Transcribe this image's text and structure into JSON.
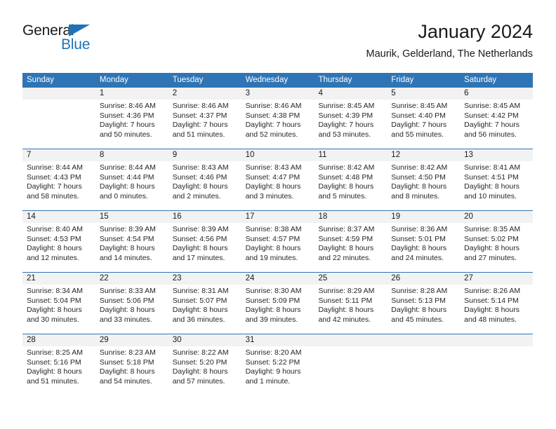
{
  "brand": {
    "word1": "General",
    "word2": "Blue",
    "triangle_color": "#1f72b8"
  },
  "header": {
    "title": "January 2024",
    "subtitle": "Maurik, Gelderland, The Netherlands"
  },
  "theme": {
    "header_blue": "#2f74b5",
    "daynum_band": "#f2f2f2",
    "text": "#262626"
  },
  "calendar": {
    "weekday_headers": [
      "Sunday",
      "Monday",
      "Tuesday",
      "Wednesday",
      "Thursday",
      "Friday",
      "Saturday"
    ],
    "weeks": [
      {
        "numbers": [
          "",
          "1",
          "2",
          "3",
          "4",
          "5",
          "6"
        ],
        "cells": [
          {
            "lines": [
              "",
              "",
              "",
              ""
            ]
          },
          {
            "lines": [
              "Sunrise: 8:46 AM",
              "Sunset: 4:36 PM",
              "Daylight: 7 hours",
              "and 50 minutes."
            ]
          },
          {
            "lines": [
              "Sunrise: 8:46 AM",
              "Sunset: 4:37 PM",
              "Daylight: 7 hours",
              "and 51 minutes."
            ]
          },
          {
            "lines": [
              "Sunrise: 8:46 AM",
              "Sunset: 4:38 PM",
              "Daylight: 7 hours",
              "and 52 minutes."
            ]
          },
          {
            "lines": [
              "Sunrise: 8:45 AM",
              "Sunset: 4:39 PM",
              "Daylight: 7 hours",
              "and 53 minutes."
            ]
          },
          {
            "lines": [
              "Sunrise: 8:45 AM",
              "Sunset: 4:40 PM",
              "Daylight: 7 hours",
              "and 55 minutes."
            ]
          },
          {
            "lines": [
              "Sunrise: 8:45 AM",
              "Sunset: 4:42 PM",
              "Daylight: 7 hours",
              "and 56 minutes."
            ]
          }
        ]
      },
      {
        "numbers": [
          "7",
          "8",
          "9",
          "10",
          "11",
          "12",
          "13"
        ],
        "cells": [
          {
            "lines": [
              "Sunrise: 8:44 AM",
              "Sunset: 4:43 PM",
              "Daylight: 7 hours",
              "and 58 minutes."
            ]
          },
          {
            "lines": [
              "Sunrise: 8:44 AM",
              "Sunset: 4:44 PM",
              "Daylight: 8 hours",
              "and 0 minutes."
            ]
          },
          {
            "lines": [
              "Sunrise: 8:43 AM",
              "Sunset: 4:46 PM",
              "Daylight: 8 hours",
              "and 2 minutes."
            ]
          },
          {
            "lines": [
              "Sunrise: 8:43 AM",
              "Sunset: 4:47 PM",
              "Daylight: 8 hours",
              "and 3 minutes."
            ]
          },
          {
            "lines": [
              "Sunrise: 8:42 AM",
              "Sunset: 4:48 PM",
              "Daylight: 8 hours",
              "and 5 minutes."
            ]
          },
          {
            "lines": [
              "Sunrise: 8:42 AM",
              "Sunset: 4:50 PM",
              "Daylight: 8 hours",
              "and 8 minutes."
            ]
          },
          {
            "lines": [
              "Sunrise: 8:41 AM",
              "Sunset: 4:51 PM",
              "Daylight: 8 hours",
              "and 10 minutes."
            ]
          }
        ]
      },
      {
        "numbers": [
          "14",
          "15",
          "16",
          "17",
          "18",
          "19",
          "20"
        ],
        "cells": [
          {
            "lines": [
              "Sunrise: 8:40 AM",
              "Sunset: 4:53 PM",
              "Daylight: 8 hours",
              "and 12 minutes."
            ]
          },
          {
            "lines": [
              "Sunrise: 8:39 AM",
              "Sunset: 4:54 PM",
              "Daylight: 8 hours",
              "and 14 minutes."
            ]
          },
          {
            "lines": [
              "Sunrise: 8:39 AM",
              "Sunset: 4:56 PM",
              "Daylight: 8 hours",
              "and 17 minutes."
            ]
          },
          {
            "lines": [
              "Sunrise: 8:38 AM",
              "Sunset: 4:57 PM",
              "Daylight: 8 hours",
              "and 19 minutes."
            ]
          },
          {
            "lines": [
              "Sunrise: 8:37 AM",
              "Sunset: 4:59 PM",
              "Daylight: 8 hours",
              "and 22 minutes."
            ]
          },
          {
            "lines": [
              "Sunrise: 8:36 AM",
              "Sunset: 5:01 PM",
              "Daylight: 8 hours",
              "and 24 minutes."
            ]
          },
          {
            "lines": [
              "Sunrise: 8:35 AM",
              "Sunset: 5:02 PM",
              "Daylight: 8 hours",
              "and 27 minutes."
            ]
          }
        ]
      },
      {
        "numbers": [
          "21",
          "22",
          "23",
          "24",
          "25",
          "26",
          "27"
        ],
        "cells": [
          {
            "lines": [
              "Sunrise: 8:34 AM",
              "Sunset: 5:04 PM",
              "Daylight: 8 hours",
              "and 30 minutes."
            ]
          },
          {
            "lines": [
              "Sunrise: 8:33 AM",
              "Sunset: 5:06 PM",
              "Daylight: 8 hours",
              "and 33 minutes."
            ]
          },
          {
            "lines": [
              "Sunrise: 8:31 AM",
              "Sunset: 5:07 PM",
              "Daylight: 8 hours",
              "and 36 minutes."
            ]
          },
          {
            "lines": [
              "Sunrise: 8:30 AM",
              "Sunset: 5:09 PM",
              "Daylight: 8 hours",
              "and 39 minutes."
            ]
          },
          {
            "lines": [
              "Sunrise: 8:29 AM",
              "Sunset: 5:11 PM",
              "Daylight: 8 hours",
              "and 42 minutes."
            ]
          },
          {
            "lines": [
              "Sunrise: 8:28 AM",
              "Sunset: 5:13 PM",
              "Daylight: 8 hours",
              "and 45 minutes."
            ]
          },
          {
            "lines": [
              "Sunrise: 8:26 AM",
              "Sunset: 5:14 PM",
              "Daylight: 8 hours",
              "and 48 minutes."
            ]
          }
        ]
      },
      {
        "numbers": [
          "28",
          "29",
          "30",
          "31",
          "",
          "",
          ""
        ],
        "cells": [
          {
            "lines": [
              "Sunrise: 8:25 AM",
              "Sunset: 5:16 PM",
              "Daylight: 8 hours",
              "and 51 minutes."
            ]
          },
          {
            "lines": [
              "Sunrise: 8:23 AM",
              "Sunset: 5:18 PM",
              "Daylight: 8 hours",
              "and 54 minutes."
            ]
          },
          {
            "lines": [
              "Sunrise: 8:22 AM",
              "Sunset: 5:20 PM",
              "Daylight: 8 hours",
              "and 57 minutes."
            ]
          },
          {
            "lines": [
              "Sunrise: 8:20 AM",
              "Sunset: 5:22 PM",
              "Daylight: 9 hours",
              "and 1 minute."
            ]
          },
          {
            "lines": [
              "",
              "",
              "",
              ""
            ]
          },
          {
            "lines": [
              "",
              "",
              "",
              ""
            ]
          },
          {
            "lines": [
              "",
              "",
              "",
              ""
            ]
          }
        ]
      }
    ]
  }
}
